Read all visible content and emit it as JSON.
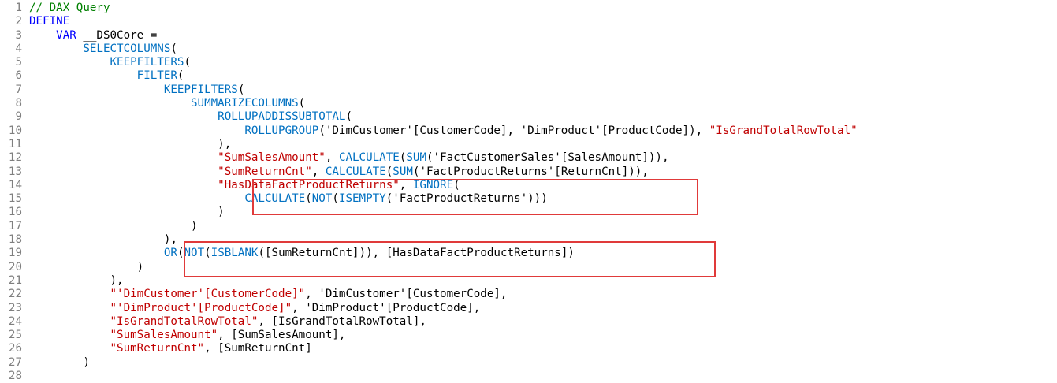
{
  "colors": {
    "keyword": "#0000ff",
    "function": "#0070c1",
    "string": "#c00000",
    "comment": "#008000",
    "text": "#000000",
    "line_number": "#7f7f7f",
    "highlight_box": "#e03a3a"
  },
  "lines": [
    {
      "n": "1",
      "tokens": [
        {
          "t": "cmt",
          "v": "// DAX Query"
        }
      ]
    },
    {
      "n": "2",
      "tokens": [
        {
          "t": "kw",
          "v": "DEFINE"
        }
      ]
    },
    {
      "n": "3",
      "tokens": [
        {
          "t": "tx",
          "v": "    "
        },
        {
          "t": "kw",
          "v": "VAR"
        },
        {
          "t": "tx",
          "v": " __DS0Core ="
        }
      ]
    },
    {
      "n": "4",
      "tokens": [
        {
          "t": "tx",
          "v": "        "
        },
        {
          "t": "fn",
          "v": "SELECTCOLUMNS"
        },
        {
          "t": "tx",
          "v": "("
        }
      ]
    },
    {
      "n": "5",
      "tokens": [
        {
          "t": "tx",
          "v": "            "
        },
        {
          "t": "fn",
          "v": "KEEPFILTERS"
        },
        {
          "t": "tx",
          "v": "("
        }
      ]
    },
    {
      "n": "6",
      "tokens": [
        {
          "t": "tx",
          "v": "                "
        },
        {
          "t": "fn",
          "v": "FILTER"
        },
        {
          "t": "tx",
          "v": "("
        }
      ]
    },
    {
      "n": "7",
      "tokens": [
        {
          "t": "tx",
          "v": "                    "
        },
        {
          "t": "fn",
          "v": "KEEPFILTERS"
        },
        {
          "t": "tx",
          "v": "("
        }
      ]
    },
    {
      "n": "8",
      "tokens": [
        {
          "t": "tx",
          "v": "                        "
        },
        {
          "t": "fn",
          "v": "SUMMARIZECOLUMNS"
        },
        {
          "t": "tx",
          "v": "("
        }
      ]
    },
    {
      "n": "9",
      "tokens": [
        {
          "t": "tx",
          "v": "                            "
        },
        {
          "t": "fn",
          "v": "ROLLUPADDISSUBTOTAL"
        },
        {
          "t": "tx",
          "v": "("
        }
      ]
    },
    {
      "n": "10",
      "tokens": [
        {
          "t": "tx",
          "v": "                                "
        },
        {
          "t": "fn",
          "v": "ROLLUPGROUP"
        },
        {
          "t": "tx",
          "v": "('DimCustomer'[CustomerCode], 'DimProduct'[ProductCode]), "
        },
        {
          "t": "str",
          "v": "\"IsGrandTotalRowTotal\""
        }
      ]
    },
    {
      "n": "11",
      "tokens": [
        {
          "t": "tx",
          "v": "                            ),"
        }
      ]
    },
    {
      "n": "12",
      "tokens": [
        {
          "t": "tx",
          "v": "                            "
        },
        {
          "t": "str",
          "v": "\"SumSalesAmount\""
        },
        {
          "t": "tx",
          "v": ", "
        },
        {
          "t": "fn",
          "v": "CALCULATE"
        },
        {
          "t": "tx",
          "v": "("
        },
        {
          "t": "fn",
          "v": "SUM"
        },
        {
          "t": "tx",
          "v": "('FactCustomerSales'[SalesAmount])),"
        }
      ]
    },
    {
      "n": "13",
      "tokens": [
        {
          "t": "tx",
          "v": "                            "
        },
        {
          "t": "str",
          "v": "\"SumReturnCnt\""
        },
        {
          "t": "tx",
          "v": ", "
        },
        {
          "t": "fn",
          "v": "CALCULATE"
        },
        {
          "t": "tx",
          "v": "("
        },
        {
          "t": "fn",
          "v": "SUM"
        },
        {
          "t": "tx",
          "v": "('FactProductReturns'[ReturnCnt])),"
        }
      ]
    },
    {
      "n": "14",
      "tokens": [
        {
          "t": "tx",
          "v": "                            "
        },
        {
          "t": "str",
          "v": "\"HasDataFactProductReturns\""
        },
        {
          "t": "tx",
          "v": ", "
        },
        {
          "t": "fn",
          "v": "IGNORE"
        },
        {
          "t": "tx",
          "v": "("
        }
      ]
    },
    {
      "n": "15",
      "tokens": [
        {
          "t": "tx",
          "v": "                                "
        },
        {
          "t": "fn",
          "v": "CALCULATE"
        },
        {
          "t": "tx",
          "v": "("
        },
        {
          "t": "fn",
          "v": "NOT"
        },
        {
          "t": "tx",
          "v": "("
        },
        {
          "t": "fn",
          "v": "ISEMPTY"
        },
        {
          "t": "tx",
          "v": "('FactProductReturns')))"
        }
      ]
    },
    {
      "n": "16",
      "tokens": [
        {
          "t": "tx",
          "v": "                            )"
        }
      ]
    },
    {
      "n": "17",
      "tokens": [
        {
          "t": "tx",
          "v": "                        )"
        }
      ]
    },
    {
      "n": "18",
      "tokens": [
        {
          "t": "tx",
          "v": "                    ),"
        }
      ]
    },
    {
      "n": "19",
      "tokens": [
        {
          "t": "tx",
          "v": "                    "
        },
        {
          "t": "fn",
          "v": "OR"
        },
        {
          "t": "tx",
          "v": "("
        },
        {
          "t": "fn",
          "v": "NOT"
        },
        {
          "t": "tx",
          "v": "("
        },
        {
          "t": "fn",
          "v": "ISBLANK"
        },
        {
          "t": "tx",
          "v": "([SumReturnCnt])), [HasDataFactProductReturns])"
        }
      ]
    },
    {
      "n": "20",
      "tokens": [
        {
          "t": "tx",
          "v": "                )"
        }
      ]
    },
    {
      "n": "21",
      "tokens": [
        {
          "t": "tx",
          "v": "            ),"
        }
      ]
    },
    {
      "n": "22",
      "tokens": [
        {
          "t": "tx",
          "v": "            "
        },
        {
          "t": "str",
          "v": "\"'DimCustomer'[CustomerCode]\""
        },
        {
          "t": "tx",
          "v": ", 'DimCustomer'[CustomerCode],"
        }
      ]
    },
    {
      "n": "23",
      "tokens": [
        {
          "t": "tx",
          "v": "            "
        },
        {
          "t": "str",
          "v": "\"'DimProduct'[ProductCode]\""
        },
        {
          "t": "tx",
          "v": ", 'DimProduct'[ProductCode],"
        }
      ]
    },
    {
      "n": "24",
      "tokens": [
        {
          "t": "tx",
          "v": "            "
        },
        {
          "t": "str",
          "v": "\"IsGrandTotalRowTotal\""
        },
        {
          "t": "tx",
          "v": ", [IsGrandTotalRowTotal],"
        }
      ]
    },
    {
      "n": "25",
      "tokens": [
        {
          "t": "tx",
          "v": "            "
        },
        {
          "t": "str",
          "v": "\"SumSalesAmount\""
        },
        {
          "t": "tx",
          "v": ", [SumSalesAmount],"
        }
      ]
    },
    {
      "n": "26",
      "tokens": [
        {
          "t": "tx",
          "v": "            "
        },
        {
          "t": "str",
          "v": "\"SumReturnCnt\""
        },
        {
          "t": "tx",
          "v": ", [SumReturnCnt]"
        }
      ]
    },
    {
      "n": "27",
      "tokens": [
        {
          "t": "tx",
          "v": "        )"
        }
      ]
    },
    {
      "n": "28",
      "tokens": []
    }
  ]
}
